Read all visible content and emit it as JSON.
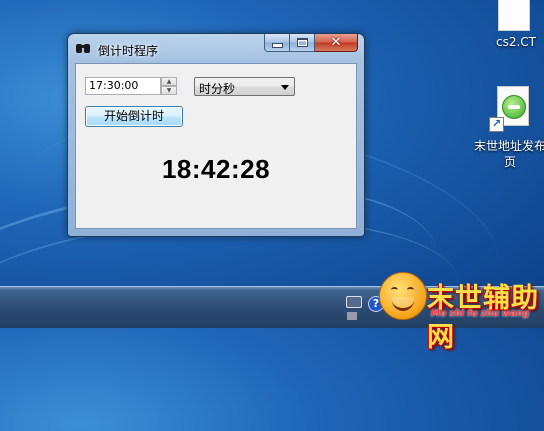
{
  "window": {
    "title": "倒计时程序",
    "close_glyph": "✕"
  },
  "form": {
    "time_value": "17:30:00",
    "unit_select": "时分秒",
    "start_button": "开始倒计时"
  },
  "display": {
    "countdown": "18:42:28"
  },
  "desktop": {
    "icons": [
      {
        "label": "cs2.CT"
      },
      {
        "label": "末世地址发布页"
      }
    ]
  },
  "taskbar": {
    "help_glyph": "?"
  },
  "watermark": {
    "text": "末世辅助网",
    "subtitle": "Mo shi fu zhu wang"
  }
}
